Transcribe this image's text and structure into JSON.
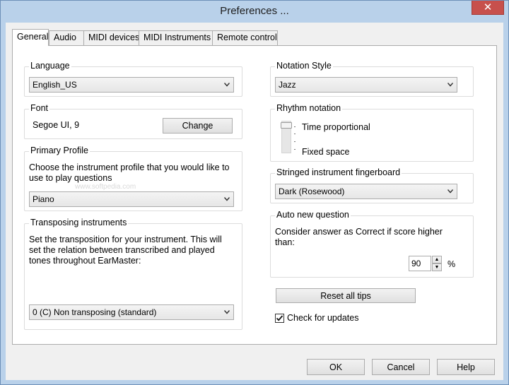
{
  "window": {
    "title": "Preferences ...",
    "close_glyph": "✕"
  },
  "tabs": [
    {
      "label": "General"
    },
    {
      "label": "Audio"
    },
    {
      "label": "MIDI devices"
    },
    {
      "label": "MIDI Instruments"
    },
    {
      "label": "Remote control"
    }
  ],
  "active_tab": "General",
  "language": {
    "title": "Language",
    "value": "English_US"
  },
  "font": {
    "title": "Font",
    "value": "Segoe UI, 9",
    "button": "Change"
  },
  "primary_profile": {
    "title": "Primary Profile",
    "description": "Choose the instrument profile that you would like to use to play questions",
    "value": "Piano",
    "watermark": "www.softpedia.com"
  },
  "transposing": {
    "title": "Transposing instruments",
    "description": "Set the transposition for your instrument. This will set the relation between transcribed and played tones throughout EarMaster:",
    "value": "0 (C) Non transposing (standard)"
  },
  "notation_style": {
    "title": "Notation Style",
    "value": "Jazz"
  },
  "rhythm_notation": {
    "title": "Rhythm notation",
    "option_top": "Time proportional",
    "option_bottom": "Fixed space",
    "selected": "Time proportional"
  },
  "fingerboard": {
    "title": "Stringed instrument fingerboard",
    "value": "Dark (Rosewood)"
  },
  "auto_new_question": {
    "title": "Auto new question",
    "description": "Consider answer as Correct if score higher than:",
    "value": "90",
    "unit": "%"
  },
  "reset_tips": {
    "label": "Reset all tips"
  },
  "check_updates": {
    "label": "Check for updates",
    "checked": true
  },
  "footer": {
    "ok": "OK",
    "cancel": "Cancel",
    "help": "Help"
  }
}
